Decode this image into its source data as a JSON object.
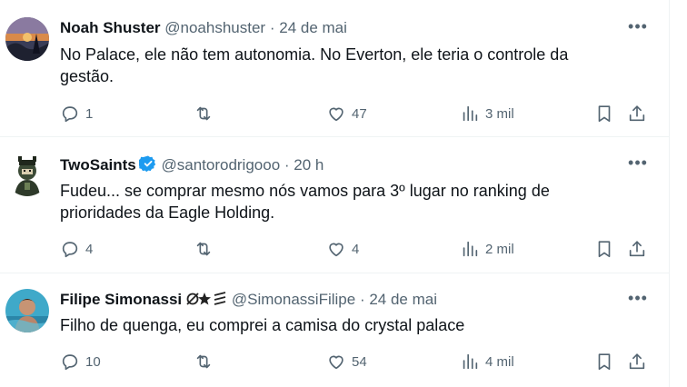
{
  "tweets": [
    {
      "name": "Noah Shuster",
      "handle": "@noahshuster",
      "separator": "·",
      "time": "24 de mai",
      "text": "No Palace, ele não tem autonomia. No Everton, ele teria o controle da gestão.",
      "replies": "1",
      "retweets": "",
      "likes": "47",
      "views": "3 mil",
      "verified": false
    },
    {
      "name": "TwoSaints",
      "handle": "@santorodrigooo",
      "separator": "·",
      "time": "20 h",
      "text": "Fudeu... se comprar mesmo nós vamos para 3º lugar no ranking de prioridades da Eagle Holding.",
      "replies": "4",
      "retweets": "",
      "likes": "4",
      "views": "2 mil",
      "verified": true
    },
    {
      "name": "Filipe Simonassi",
      "handle": "@SimonassiFilipe",
      "separator": "·",
      "time": "24 de mai",
      "text": "Filho de quenga, eu comprei a camisa do crystal palace",
      "replies": "10",
      "retweets": "",
      "likes": "54",
      "views": "4 mil",
      "verified": false
    }
  ],
  "icons": {
    "more": "more-dots-icon",
    "reply": "reply-bubble-icon",
    "retweet": "retweet-arrows-icon",
    "like": "heart-icon",
    "views": "views-bars-icon",
    "bookmark": "bookmark-icon",
    "share": "share-upload-icon"
  },
  "colors": {
    "text": "#0f1419",
    "muted": "#536471",
    "verified": "#1d9bf0",
    "divider": "#eff3f4"
  }
}
